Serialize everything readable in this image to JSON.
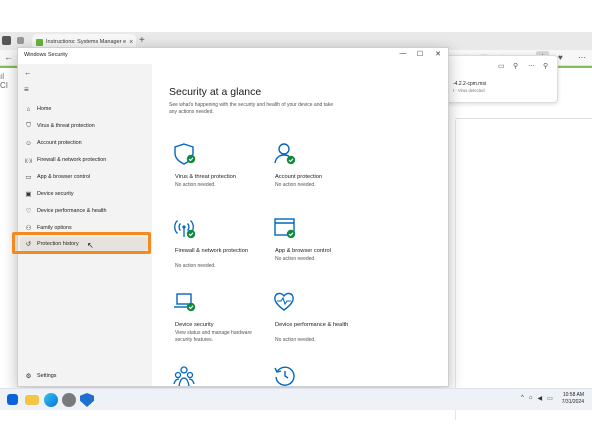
{
  "browser": {
    "tab_title": "Instructions: Systems Manager e",
    "tab_close": "×",
    "new_tab": "+",
    "download": {
      "filename": "-4.2.2-cpm.msi",
      "status": "t · Virus detected"
    },
    "left_stub": "ıl\nCI"
  },
  "window": {
    "title": "Windows Security",
    "controls": {
      "minimize": "—",
      "maximize": "☐",
      "close": "✕"
    }
  },
  "sidebar": {
    "back_glyph": "←",
    "menu_glyph": "≡",
    "items": [
      {
        "label": "Home",
        "icon": "⌂"
      },
      {
        "label": "Virus & threat protection",
        "icon": "⛉"
      },
      {
        "label": "Account protection",
        "icon": "☺"
      },
      {
        "label": "Firewall & network protection",
        "icon": "((·))"
      },
      {
        "label": "App & browser control",
        "icon": "▭"
      },
      {
        "label": "Device security",
        "icon": "▣"
      },
      {
        "label": "Device performance & health",
        "icon": "♡"
      },
      {
        "label": "Family options",
        "icon": "⚇"
      },
      {
        "label": "Protection history",
        "icon": "↺"
      }
    ],
    "settings": {
      "label": "Settings",
      "icon": "⚙"
    }
  },
  "main": {
    "title": "Security at a glance",
    "description": "See what's happening with the security and health of your device and take any actions needed.",
    "cards": [
      {
        "title": "Virus & threat protection",
        "status": "No action needed.",
        "icon": "shield-icon"
      },
      {
        "title": "Account protection",
        "status": "No action needed.",
        "icon": "person-icon"
      },
      {
        "title": "Firewall & network protection",
        "status": "No action needed.",
        "icon": "wifi-icon"
      },
      {
        "title": "App & browser control",
        "status": "No action needed.",
        "icon": "window-icon"
      },
      {
        "title": "Device security",
        "status": "View status and manage hardware security features.",
        "icon": "laptop-icon"
      },
      {
        "title": "Device performance & health",
        "status": "No action needed.",
        "icon": "heart-icon"
      },
      {
        "title": "",
        "status": "",
        "icon": "family-icon"
      },
      {
        "title": "",
        "status": "",
        "icon": "history-icon"
      }
    ]
  },
  "taskbar": {
    "time": "10:58 AM",
    "date": "7/31/2024"
  },
  "colors": {
    "accent": "#0067c0",
    "ok_green": "#10893e",
    "highlight": "#f28a20",
    "brand_green": "#6cb33e"
  }
}
